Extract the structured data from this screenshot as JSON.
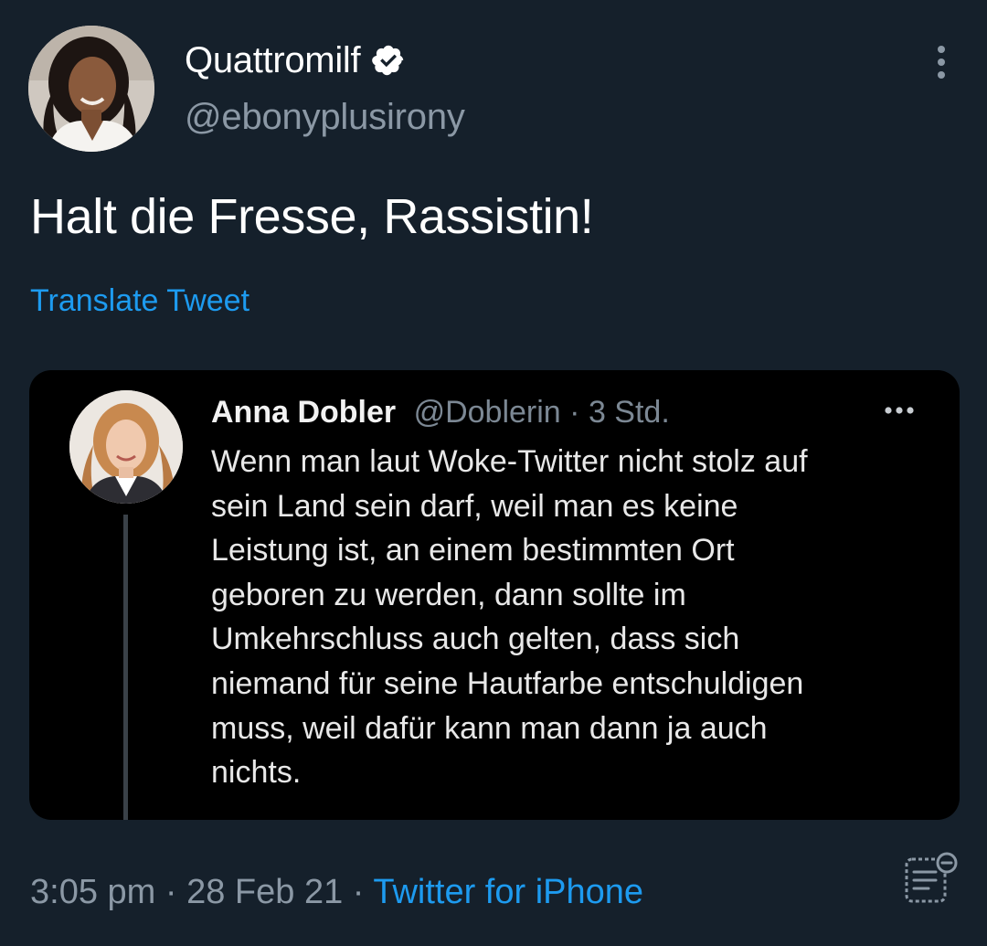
{
  "author": {
    "display_name": "Quattromilf",
    "handle": "@ebonyplusirony",
    "verified": true
  },
  "tweet": {
    "text": "Halt die Fresse, Rassistin!",
    "translate_label": "Translate Tweet"
  },
  "quoted_tweet": {
    "display_name": "Anna Dobler",
    "handle": "@Doblerin",
    "separator": " · ",
    "age": "3 Std.",
    "lines": [
      "Wenn man laut Woke-Twitter nicht stolz auf",
      "sein Land sein darf, weil man es keine",
      "Leistung ist, an einem bestimmten Ort",
      "geboren zu werden, dann sollte im",
      "Umkehrschluss auch gelten, dass sich",
      "niemand für seine Hautfarbe entschuldigen",
      "muss, weil dafür kann man dann ja auch",
      "nichts."
    ]
  },
  "footer": {
    "time": "3:05 pm",
    "separator": " · ",
    "date": "28 Feb 21",
    "source": "Twitter for iPhone"
  },
  "icons": {
    "verified": "verified-badge-icon",
    "more": "more-vertical-icon",
    "quote_more": "more-horizontal-icon",
    "notes": "notes-icon"
  },
  "colors": {
    "background": "#15202b",
    "quote_background": "#000000",
    "link": "#1d9bf0",
    "secondary_text": "#8b98a5"
  }
}
